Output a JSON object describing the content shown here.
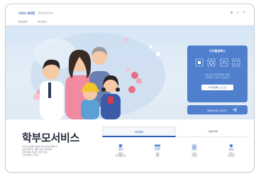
{
  "header": {
    "logo_text": "나이스 대국민",
    "logo_sub": "학부모서비스",
    "nav": [
      "학교정보",
      "자녀관리"
    ],
    "window_controls": [
      "minimize-icon",
      "restore-icon",
      "close-icon"
    ]
  },
  "id_panel": {
    "title": "디지털원패스",
    "icons": [
      "qr-icon",
      "face-icon",
      "fingerprint-icon",
      "pattern-icon"
    ],
    "note_lines": [
      "본인인증 수단을 선택하여 주세요",
      "간편하게 로그인할 수 있습니다"
    ],
    "login_button": "디지털원패스 로그인",
    "secondary_button": "학부모서비스 로그인"
  },
  "service": {
    "title": "학부모서비스",
    "desc_lines": [
      "자녀 학교생활 정보를 학부모서비스에서 한",
      "눈에 확인하고 각종 신청을 간편하게",
      "처리하세요 학교와 가정을 잇는",
      "학부모서비스 입니다"
    ]
  },
  "tabs": {
    "active": "자녀정보",
    "inactive": "신청/조회"
  },
  "services": [
    {
      "icon": "report-icon",
      "label_1": "성적및",
      "label_2": "학교생활기록"
    },
    {
      "icon": "calendar-icon",
      "label_1": "출결",
      "label_2": "현황"
    },
    {
      "icon": "document-icon",
      "label_1": "온라인",
      "label_2": "신청서"
    },
    {
      "icon": "person-icon",
      "label_1": "학부모",
      "label_2": "상담신청"
    }
  ],
  "colors": {
    "accent": "#4f7fcd",
    "brand": "#2f5bb7",
    "hero_bg": "#dbe8f6"
  }
}
